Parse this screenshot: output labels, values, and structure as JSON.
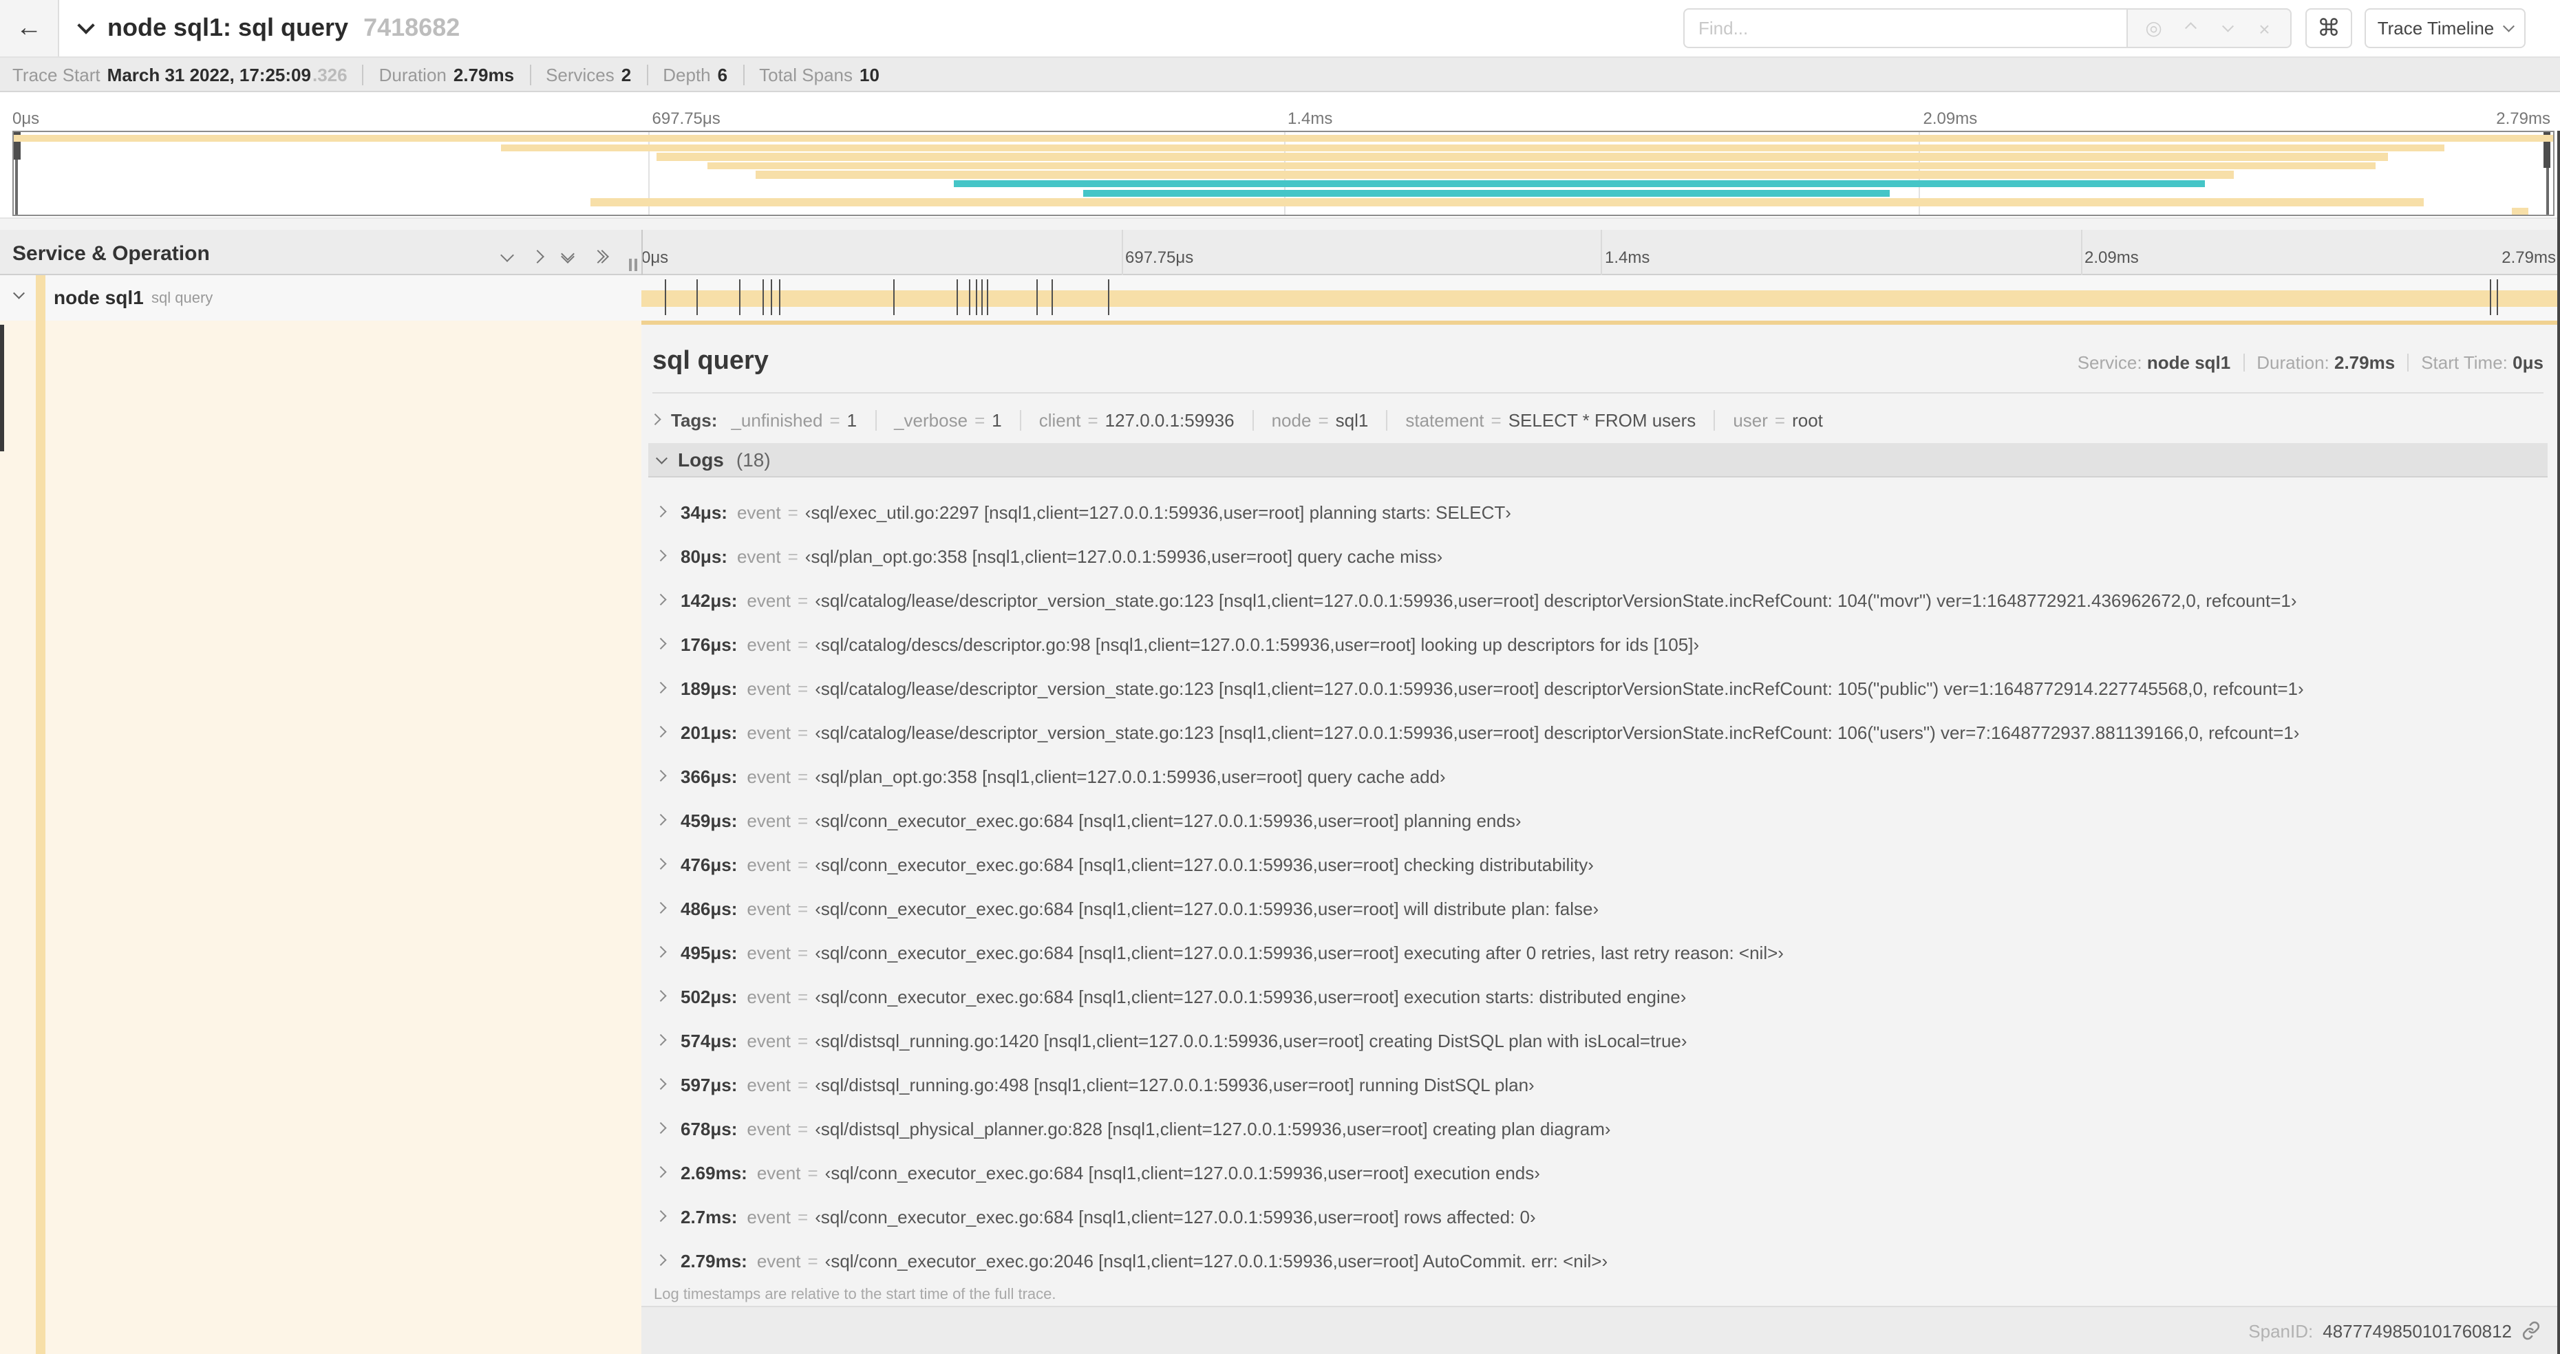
{
  "header": {
    "back_arrow": "←",
    "title": "node sql1: sql query",
    "trace_id": "7418682",
    "find_placeholder": "Find...",
    "locate_icon": "◎",
    "clear_icon": "×",
    "shortcut_key": "⌘",
    "view_select": "Trace Timeline"
  },
  "meta": {
    "items": [
      {
        "label": "Trace Start",
        "value": "March 31 2022, 17:25:09",
        "suffix": ".326"
      },
      {
        "label": "Duration",
        "value": "2.79ms"
      },
      {
        "label": "Services",
        "value": "2"
      },
      {
        "label": "Depth",
        "value": "6"
      },
      {
        "label": "Total Spans",
        "value": "10"
      }
    ]
  },
  "axis_ticks": [
    {
      "label": "0μs",
      "pct": 0
    },
    {
      "label": "697.75μs",
      "pct": 25
    },
    {
      "label": "1.4ms",
      "pct": 50
    },
    {
      "label": "2.09ms",
      "pct": 75
    },
    {
      "label": "2.79ms",
      "pct": 100
    }
  ],
  "chart_data": {
    "type": "gantt-minimap",
    "title": "trace span overview",
    "xlabel_ticks": [
      "0μs",
      "697.75μs",
      "1.4ms",
      "2.09ms",
      "2.79ms"
    ],
    "total_duration_us": 2790,
    "spans_pct": [
      {
        "start": 0,
        "end": 100,
        "color": "tan"
      },
      {
        "start": 19.2,
        "end": 95.7,
        "color": "tan"
      },
      {
        "start": 25.3,
        "end": 93.5,
        "color": "tan"
      },
      {
        "start": 27.3,
        "end": 93.0,
        "color": "tan"
      },
      {
        "start": 29.2,
        "end": 87.4,
        "color": "tan"
      },
      {
        "start": 37.0,
        "end": 86.3,
        "color": "teal"
      },
      {
        "start": 42.1,
        "end": 73.9,
        "color": "teal"
      },
      {
        "start": 22.7,
        "end": 94.9,
        "color": "tan"
      },
      {
        "start": 98.4,
        "end": 99.0,
        "color": "tan"
      }
    ]
  },
  "section": {
    "title": "Service & Operation"
  },
  "row": {
    "service": "node sql1",
    "operation": "sql query"
  },
  "detail": {
    "operation": "sql query",
    "service_label": "Service:",
    "service": "node sql1",
    "duration_label": "Duration:",
    "duration": "2.79ms",
    "start_label": "Start Time:",
    "start": "0μs"
  },
  "tags": {
    "label": "Tags:",
    "items": [
      {
        "key": "_unfinished",
        "value": "1"
      },
      {
        "key": "_verbose",
        "value": "1"
      },
      {
        "key": "client",
        "value": "127.0.0.1:59936"
      },
      {
        "key": "node",
        "value": "sql1"
      },
      {
        "key": "statement",
        "value": "SELECT * FROM users"
      },
      {
        "key": "user",
        "value": "root"
      }
    ]
  },
  "logs": {
    "label": "Logs",
    "count": "(18)",
    "key": "event",
    "duration_us": 2790,
    "items": [
      {
        "t": "34μs:",
        "us": 34,
        "v": "sql/exec_util.go:2297 [nsql1,client=127.0.0.1:59936,user=root] planning starts: SELECT"
      },
      {
        "t": "80μs:",
        "us": 80,
        "v": "sql/plan_opt.go:358 [nsql1,client=127.0.0.1:59936,user=root] query cache miss"
      },
      {
        "t": "142μs:",
        "us": 142,
        "v": "sql/catalog/lease/descriptor_version_state.go:123 [nsql1,client=127.0.0.1:59936,user=root] descriptorVersionState.incRefCount: 104(\"movr\") ver=1:1648772921.436962672,0, refcount=1"
      },
      {
        "t": "176μs:",
        "us": 176,
        "v": "sql/catalog/descs/descriptor.go:98 [nsql1,client=127.0.0.1:59936,user=root] looking up descriptors for ids [105]"
      },
      {
        "t": "189μs:",
        "us": 189,
        "v": "sql/catalog/lease/descriptor_version_state.go:123 [nsql1,client=127.0.0.1:59936,user=root] descriptorVersionState.incRefCount: 105(\"public\") ver=1:1648772914.227745568,0, refcount=1"
      },
      {
        "t": "201μs:",
        "us": 201,
        "v": "sql/catalog/lease/descriptor_version_state.go:123 [nsql1,client=127.0.0.1:59936,user=root] descriptorVersionState.incRefCount: 106(\"users\") ver=7:1648772937.881139166,0, refcount=1"
      },
      {
        "t": "366μs:",
        "us": 366,
        "v": "sql/plan_opt.go:358 [nsql1,client=127.0.0.1:59936,user=root] query cache add"
      },
      {
        "t": "459μs:",
        "us": 459,
        "v": "sql/conn_executor_exec.go:684 [nsql1,client=127.0.0.1:59936,user=root] planning ends"
      },
      {
        "t": "476μs:",
        "us": 476,
        "v": "sql/conn_executor_exec.go:684 [nsql1,client=127.0.0.1:59936,user=root] checking distributability"
      },
      {
        "t": "486μs:",
        "us": 486,
        "v": "sql/conn_executor_exec.go:684 [nsql1,client=127.0.0.1:59936,user=root] will distribute plan: false"
      },
      {
        "t": "495μs:",
        "us": 495,
        "v": "sql/conn_executor_exec.go:684 [nsql1,client=127.0.0.1:59936,user=root] executing after 0 retries, last retry reason: <nil>"
      },
      {
        "t": "502μs:",
        "us": 502,
        "v": "sql/conn_executor_exec.go:684 [nsql1,client=127.0.0.1:59936,user=root] execution starts: distributed engine"
      },
      {
        "t": "574μs:",
        "us": 574,
        "v": "sql/distsql_running.go:1420 [nsql1,client=127.0.0.1:59936,user=root] creating DistSQL plan with isLocal=true"
      },
      {
        "t": "597μs:",
        "us": 597,
        "v": "sql/distsql_running.go:498 [nsql1,client=127.0.0.1:59936,user=root] running DistSQL plan"
      },
      {
        "t": "678μs:",
        "us": 678,
        "v": "sql/distsql_physical_planner.go:828 [nsql1,client=127.0.0.1:59936,user=root] creating plan diagram"
      },
      {
        "t": "2.69ms:",
        "us": 2690,
        "v": "sql/conn_executor_exec.go:684 [nsql1,client=127.0.0.1:59936,user=root] execution ends"
      },
      {
        "t": "2.7ms:",
        "us": 2700,
        "v": "sql/conn_executor_exec.go:684 [nsql1,client=127.0.0.1:59936,user=root] rows affected: 0"
      },
      {
        "t": "2.79ms:",
        "us": 2790,
        "v": "sql/conn_executor_exec.go:2046 [nsql1,client=127.0.0.1:59936,user=root] AutoCommit. err: <nil>"
      }
    ],
    "note": "Log timestamps are relative to the start time of the full trace."
  },
  "footer": {
    "spanid_label": "SpanID:",
    "spanid": "4877749850101760812"
  },
  "colors": {
    "tan": "#f7dfa8",
    "teal": "#45c5c7",
    "selected_bg": "#fdf5e7",
    "detail_border": "#f0d190"
  }
}
